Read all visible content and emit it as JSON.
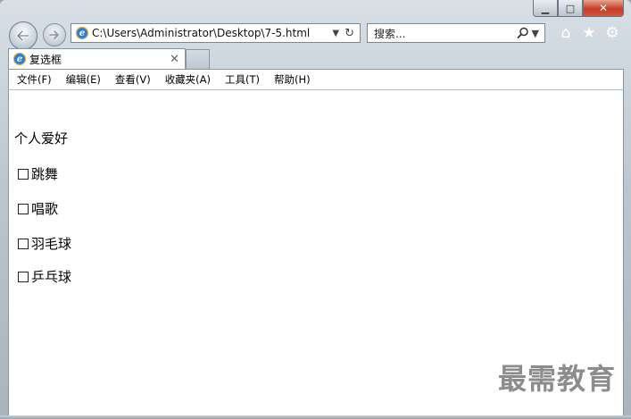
{
  "window": {
    "controls": {
      "minimize": "▁",
      "maximize": "□",
      "close": "✕"
    }
  },
  "nav": {
    "back_icon": "arrow-left-icon",
    "forward_icon": "arrow-right-icon",
    "address": "C:\\Users\\Administrator\\Desktop\\7-5.html",
    "search_placeholder": "搜索...",
    "tool_icons": [
      "home-icon",
      "favorites-star-icon",
      "settings-gear-icon"
    ]
  },
  "tab": {
    "title": "复选框"
  },
  "menu": {
    "items": [
      "文件(F)",
      "编辑(E)",
      "查看(V)",
      "收藏夹(A)",
      "工具(T)",
      "帮助(H)"
    ]
  },
  "page": {
    "heading": "个人爱好",
    "checkboxes": [
      {
        "label": "跳舞",
        "checked": false
      },
      {
        "label": "唱歌",
        "checked": false
      },
      {
        "label": "羽毛球",
        "checked": false
      },
      {
        "label": "乒乓球",
        "checked": false
      }
    ]
  },
  "watermark": "最需教育"
}
